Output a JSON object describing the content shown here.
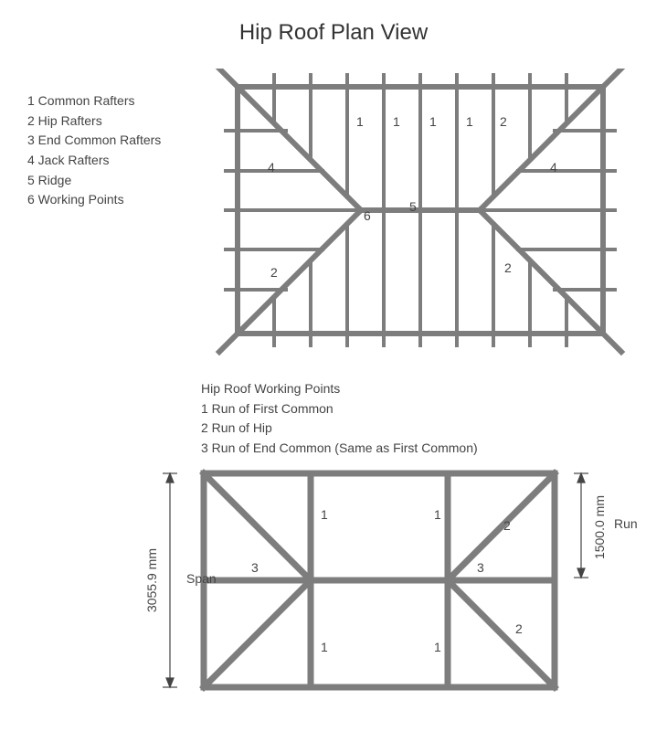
{
  "title": "Hip Roof Plan View",
  "legend_top": [
    "1 Common Rafters",
    "2 Hip Rafters",
    "3 End Common Rafters",
    "4 Jack Rafters",
    "5 Ridge",
    "6 Working Points"
  ],
  "legend_bottom_heading": "Hip Roof Working Points",
  "legend_bottom": [
    "1 Run of First Common",
    "2 Run of Hip",
    "3 Run of End Common (Same as First Common)"
  ],
  "dimensions": {
    "span_label": "Span",
    "span_value": "3055.9 mm",
    "run_label": "Run",
    "run_value": "1500.0 mm"
  },
  "top_diagram_numbers": {
    "n1": "1",
    "n2": "2",
    "n4": "4",
    "n5": "5",
    "n6": "6"
  },
  "bottom_diagram_numbers": {
    "n1": "1",
    "n2": "2",
    "n3": "3"
  }
}
